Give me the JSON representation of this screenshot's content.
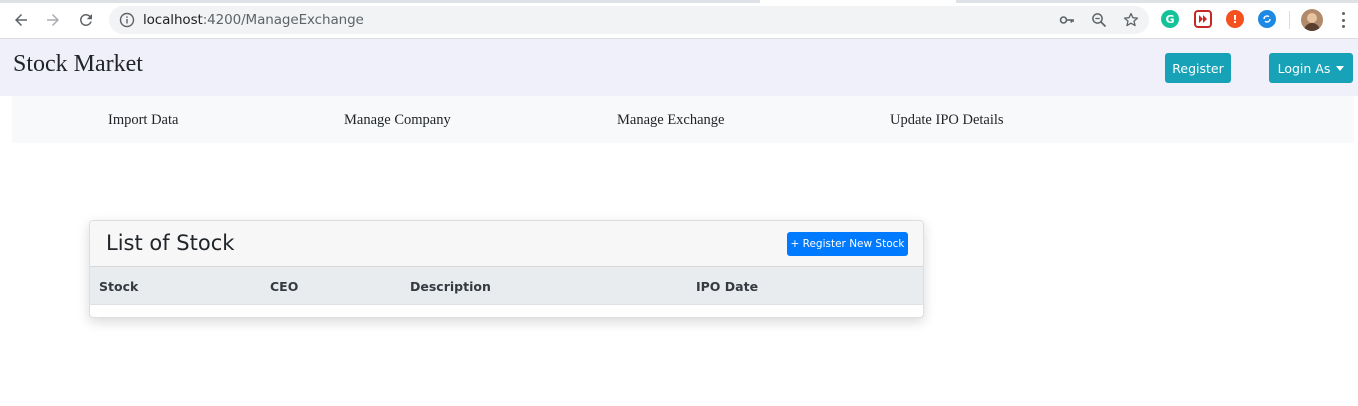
{
  "browser": {
    "url_host": "localhost",
    "url_path": ":4200/ManageExchange"
  },
  "navbar": {
    "brand": "Stock Market",
    "register_label": "Register",
    "login_label": "Login As"
  },
  "subnav": {
    "items": [
      {
        "label": "Import Data"
      },
      {
        "label": "Manage Company"
      },
      {
        "label": "Manage Exchange"
      },
      {
        "label": "Update IPO Details"
      }
    ]
  },
  "card": {
    "title": "List of Stock",
    "register_button_label": "+ Register New Stock",
    "columns": [
      "Stock",
      "CEO",
      "Description",
      "IPO Date"
    ],
    "rows": []
  },
  "colors": {
    "info": "#17a2b8",
    "primary": "#007bff",
    "navbar_bg": "#f0f0fb",
    "subnav_bg": "#f8f9fa",
    "table_head_bg": "#e9ecef"
  }
}
